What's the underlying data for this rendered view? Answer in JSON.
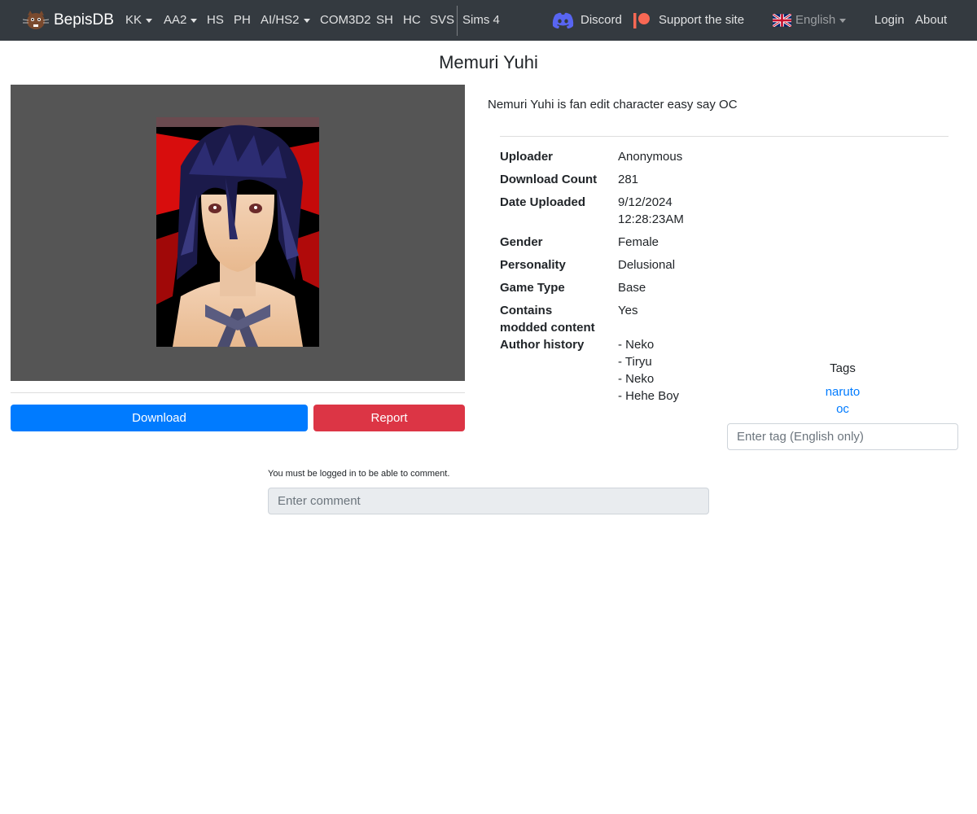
{
  "nav": {
    "brand": "BepisDB",
    "items": [
      {
        "label": "KK",
        "dropdown": true
      },
      {
        "label": "AA2",
        "dropdown": true
      },
      {
        "label": "HS",
        "dropdown": false
      },
      {
        "label": "PH",
        "dropdown": false
      },
      {
        "label": "AI/HS2",
        "dropdown": true
      },
      {
        "label": "COM3D2",
        "dropdown": false
      },
      {
        "label": "SH",
        "dropdown": false
      },
      {
        "label": "HC",
        "dropdown": false
      },
      {
        "label": "SVS",
        "dropdown": false
      },
      {
        "label": "Sims 4",
        "dropdown": false
      }
    ],
    "discord": "Discord",
    "support": "Support the site",
    "language": "English",
    "login": "Login",
    "about": "About"
  },
  "card": {
    "title": "Memuri Yuhi",
    "description": "Nemuri Yuhi is fan edit character easy say OC",
    "download_label": "Download",
    "report_label": "Report"
  },
  "info": {
    "uploader_label": "Uploader",
    "uploader": "Anonymous",
    "download_count_label": "Download Count",
    "download_count": "281",
    "date_label": "Date Uploaded",
    "date_line1": "9/12/2024",
    "date_line2": "12:28:23AM",
    "gender_label": "Gender",
    "gender": "Female",
    "personality_label": "Personality",
    "personality": "Delusional",
    "game_type_label": "Game Type",
    "game_type": "Base",
    "modded_label_line1": "Contains",
    "modded_label_line2": "modded content",
    "modded": "Yes",
    "author_history_label": "Author history",
    "author_history": [
      "- Neko",
      "- Tiryu",
      "- Neko",
      "- Hehe Boy"
    ]
  },
  "tags": {
    "title": "Tags",
    "items": [
      "naruto",
      "oc"
    ],
    "input_placeholder": "Enter tag (English only)"
  },
  "comments": {
    "note": "You must be logged in to be able to comment.",
    "input_placeholder": "Enter comment"
  },
  "colors": {
    "navbar": "#343a40",
    "primary": "#007bff",
    "danger": "#dc3545",
    "discord": "#5865F2",
    "patreon": "#f96854"
  }
}
